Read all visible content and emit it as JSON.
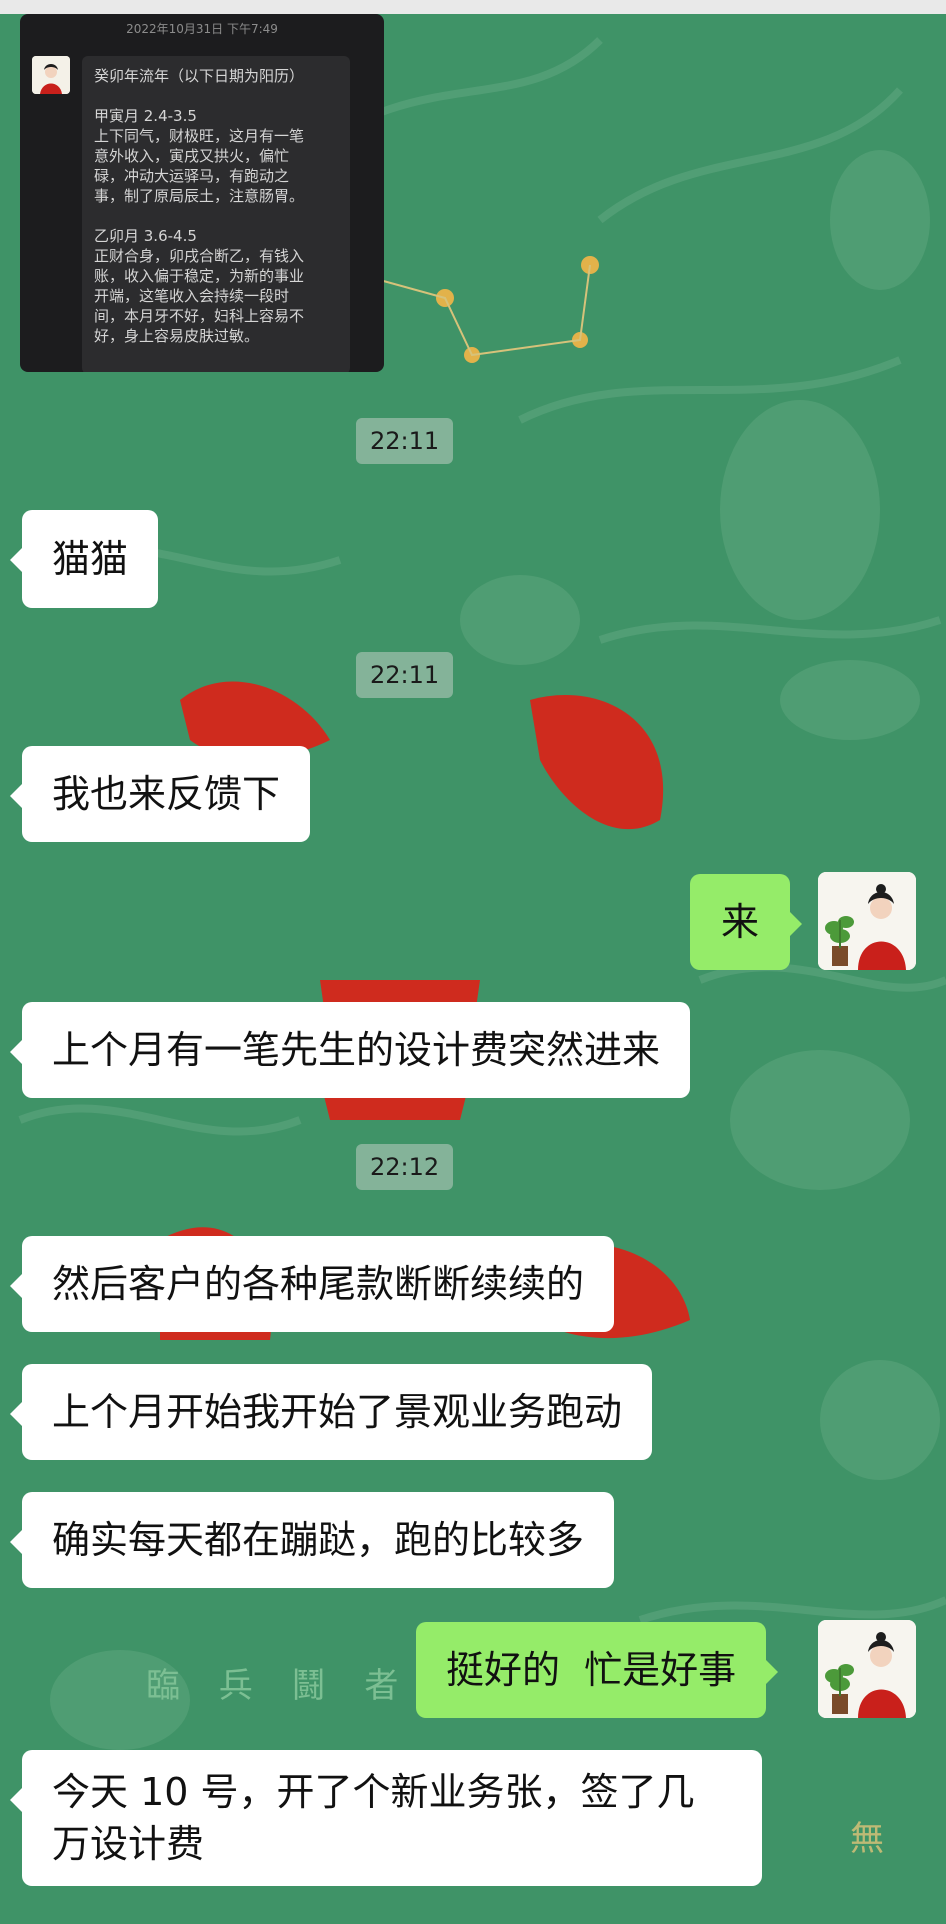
{
  "forwarded_screenshot": {
    "timestamp": "2022年10月31日 下午7:49",
    "lines": [
      "癸卯年流年（以下日期为阳历）",
      "",
      "甲寅月 2.4-3.5",
      "上下同气，财极旺，这月有一笔",
      "意外收入，寅戌又拱火，偏忙",
      "碌，冲动大运驿马，有跑动之",
      "事，制了原局辰土，注意肠胃。",
      "",
      "乙卯月 3.6-4.5",
      "正财合身，卯戌合断乙，有钱入",
      "账，收入偏于稳定，为新的事业",
      "开端，这笔收入会持续一段时",
      "间，本月牙不好，妇科上容易不",
      "好，身上容易皮肤过敏。"
    ]
  },
  "timestamps": [
    "22:11",
    "22:11",
    "22:12"
  ],
  "messages": [
    {
      "side": "left",
      "text": "猫猫"
    },
    {
      "side": "left",
      "text": "我也来反馈下"
    },
    {
      "side": "right",
      "text": "来"
    },
    {
      "side": "left",
      "text": "上个月有一笔先生的设计费突然进来"
    },
    {
      "side": "left",
      "text": "然后客户的各种尾款断断续续的"
    },
    {
      "side": "left",
      "text": "上个月开始我开始了景观业务跑动"
    },
    {
      "side": "left",
      "text": "确实每天都在蹦跶，跑的比较多"
    },
    {
      "side": "right",
      "text": "挺好的  忙是好事"
    },
    {
      "side": "left",
      "text": "今天 10 号，开了个新业务张，签了几万设计费"
    }
  ],
  "background_text": [
    "臨 兵 鬪 者 皆"
  ],
  "colors": {
    "chat_background": "#3f9367",
    "incoming_bubble": "#ffffff",
    "outgoing_bubble": "#95ec69",
    "timestamp_chip": "#bcd0c3"
  }
}
